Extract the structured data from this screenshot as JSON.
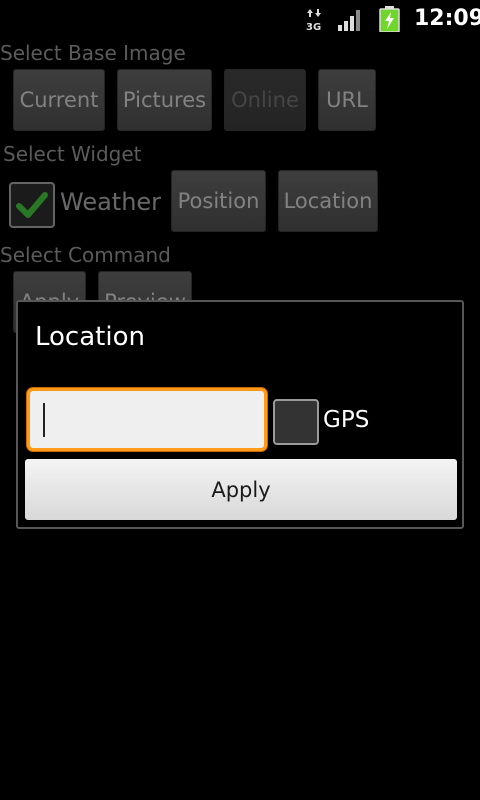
{
  "status_bar": {
    "network": "3G",
    "time": "12:09"
  },
  "base_image": {
    "label": "Select Base Image",
    "buttons": [
      "Current",
      "Pictures",
      "Online",
      "URL"
    ]
  },
  "widget": {
    "label": "Select Widget",
    "weather_label": "Weather",
    "weather_checked": true,
    "buttons": [
      "Position",
      "Location"
    ]
  },
  "command": {
    "label": "Select Command",
    "buttons": [
      "Apply",
      "Preview"
    ]
  },
  "dialog": {
    "title": "Location",
    "input_value": "",
    "gps_label": "GPS",
    "gps_checked": false,
    "apply_label": "Apply"
  },
  "colors": {
    "focus_accent": "#ff9a1a",
    "check_green": "#3fb83a",
    "battery_green": "#6fd62a"
  }
}
